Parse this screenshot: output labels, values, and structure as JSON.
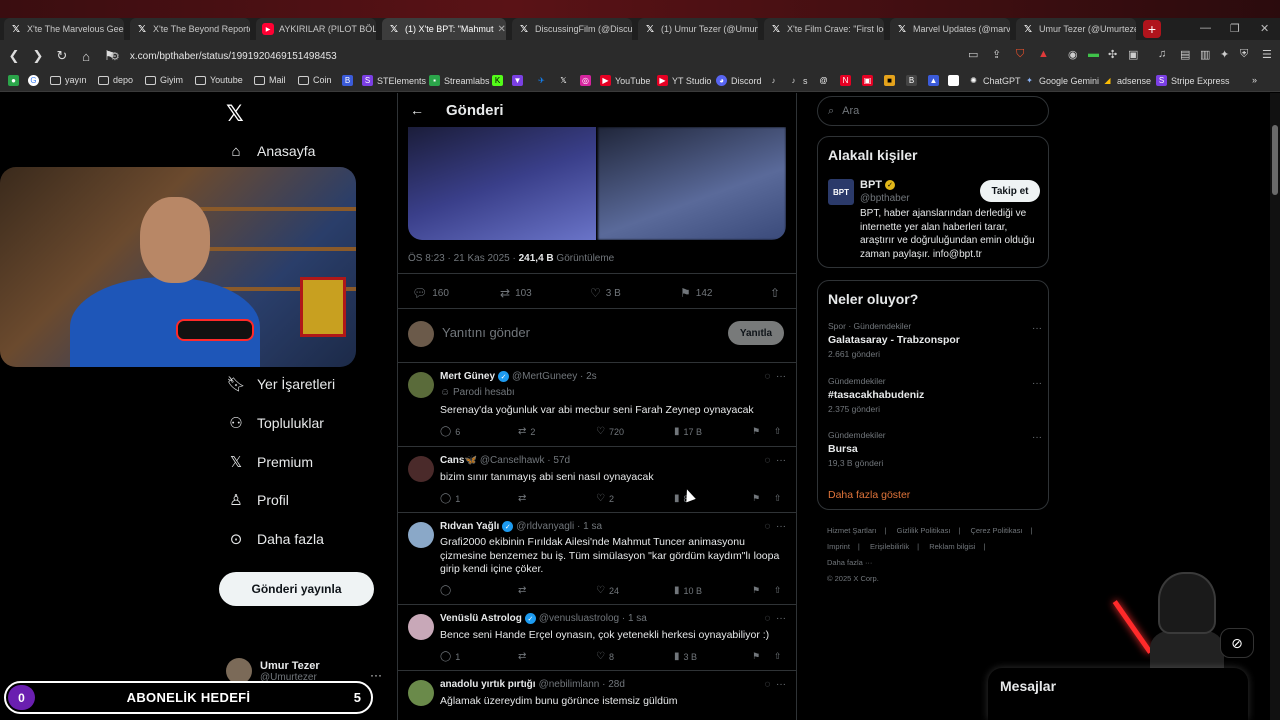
{
  "browser": {
    "tabs": [
      {
        "label": "X'te The Marvelous Geeks",
        "icon": "x-icon"
      },
      {
        "label": "X'te The Beyond Reporter",
        "icon": "x-icon"
      },
      {
        "label": "AYKIRILAR (PILOT BÖLÜM)",
        "icon": "youtube-icon"
      },
      {
        "label": "(1) X'te BPT: \"Mahmut",
        "icon": "x-icon",
        "active": true
      },
      {
        "label": "DiscussingFilm (@Discuss",
        "icon": "x-icon"
      },
      {
        "label": "(1) Umur Tezer (@Umurtez",
        "icon": "x-icon"
      },
      {
        "label": "X'te Film Crave: \"First look",
        "icon": "x-icon"
      },
      {
        "label": "Marvel Updates (@marvel",
        "icon": "x-icon"
      },
      {
        "label": "Umur Tezer (@Umurtezer)",
        "icon": "x-icon"
      }
    ],
    "url": "x.com/bpthaber/status/1991920469151498453",
    "bookmarks": [
      "yayın",
      "depo",
      "Giyim",
      "Youtube",
      "Mail",
      "Coin",
      "STElements",
      "Streamlabs",
      "YouTube",
      "YT Studio",
      "Discord",
      "s",
      "ChatGPT",
      "Google Gemini",
      "adsense",
      "Stripe Express"
    ]
  },
  "nav": {
    "home": "Anasayfa",
    "bookmarks": "Yer İşaretleri",
    "communities": "Topluluklar",
    "premium": "Premium",
    "profile": "Profil",
    "more": "Daha fazla",
    "post_button": "Gönderi yayınla",
    "user_name": "Umur Tezer",
    "user_handle": "@Umurtezer"
  },
  "post": {
    "header_title": "Gönderi",
    "time": "ÖS 8:23 · 21 Kas 2025 · ",
    "views_value": "241,4 B",
    "views_label": " Görüntüleme",
    "replies": "160",
    "reposts": "103",
    "likes": "3 B",
    "bookmarks": "142",
    "reply_placeholder": "Yanıtını gönder",
    "reply_button": "Yanıtla"
  },
  "replies": [
    {
      "name": "Mert Güney",
      "verified": true,
      "handle": "@MertGuneey · 2s",
      "parody": "Parodi hesabı",
      "text": "Serenay'da yoğunluk var abi mecbur seni Farah Zeynep oynayacak",
      "replies": "6",
      "reposts": "2",
      "likes": "720",
      "views": "17 B",
      "avatar_color": "#5a6b3a"
    },
    {
      "name": "Cans🦋",
      "verified": false,
      "handle": "@Canselhawk · 57d",
      "text": "bizim sınır tanımayış abi seni nasıl oynayacak",
      "replies": "1",
      "reposts": "",
      "likes": "2",
      "views": "8",
      "avatar_color": "#4a2a2a"
    },
    {
      "name": "Rıdvan Yağlı",
      "verified": true,
      "handle": "@rldvanyagli · 1 sa",
      "text": "Grafi2000 ekibinin Fırıldak Ailesi'nde Mahmut Tuncer animasyonu çizmesine benzemez bu iş. Tüm simülasyon \"kar gördüm kaydım\"lı loopa girip kendi içine çöker.",
      "replies": "",
      "reposts": "",
      "likes": "24",
      "views": "10 B",
      "avatar_color": "#8aa8c8"
    },
    {
      "name": "Venüslü Astrolog",
      "verified": true,
      "handle": "@venusluastrolog · 1 sa",
      "text": "Bence seni Hande Erçel oynasın, çok yetenekli herkesi oynayabiliyor :)",
      "replies": "1",
      "reposts": "",
      "likes": "8",
      "views": "3 B",
      "avatar_color": "#c8a8b8"
    },
    {
      "name": "anadolu yırtık pırtığı",
      "verified": false,
      "handle": "@nebilimlann · 28d",
      "text": "Ağlamak üzereydim bunu görünce istemsiz güldüm",
      "avatar_color": "#6a8a4a"
    }
  ],
  "right": {
    "search_placeholder": "Ara",
    "related_title": "Alakalı kişiler",
    "bpt_logo": "BPT",
    "bpt_name": "BPT",
    "bpt_handle": "@bpthaber",
    "bpt_bio": "BPT, haber ajanslarından derlediği ve internette yer alan haberleri tarar, araştırır ve doğruluğundan emin olduğu zaman paylaşır. info@bpt.tr",
    "follow_button": "Takip et",
    "trends_title": "Neler oluyor?",
    "trends": [
      {
        "category": "Spor · Gündemdekiler",
        "title": "Galatasaray - Trabzonspor",
        "count": "2.661 gönderi"
      },
      {
        "category": "Gündemdekiler",
        "title": "#tasacakhabudeniz",
        "count": "2.375 gönderi"
      },
      {
        "category": "Gündemdekiler",
        "title": "Bursa",
        "count": "19,3 B gönderi"
      }
    ],
    "show_more": "Daha fazla göster",
    "footer": [
      "Hizmet Şartları",
      "|",
      "Gizlilik Politikası",
      "|",
      "Çerez Politikası",
      "|",
      "Imprint",
      "|",
      "Erişilebilirlik",
      "|",
      "Reklam bilgisi",
      "|",
      "Daha fazla ···",
      "© 2025 X Corp."
    ],
    "messages": "Mesajlar"
  },
  "overlay": {
    "goal_left": "0",
    "goal_title": "ABONELİK HEDEFİ",
    "goal_right": "5"
  },
  "colors": {
    "accent_link": "#e0743a",
    "verified": "#1d9bf0",
    "goal_badge": "#6a1fb0"
  }
}
